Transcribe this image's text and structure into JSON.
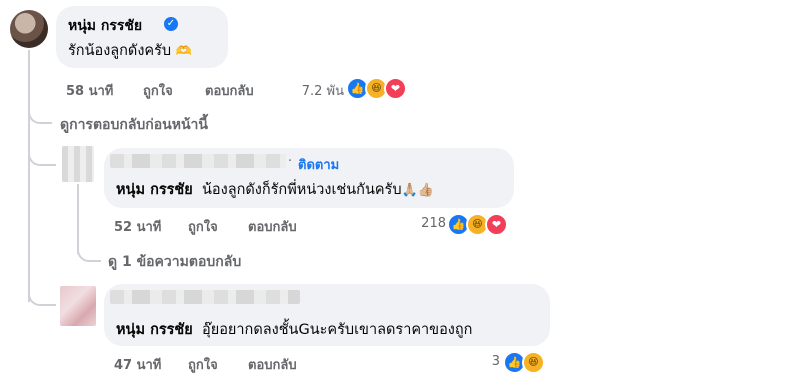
{
  "comment": {
    "author": "หนุ่ม กรรชัย",
    "text": "รักน้องลูกดังครับ",
    "emoji": "🫶",
    "time": "58 นาที",
    "like_label": "ถูกใจ",
    "reply_label": "ตอบกลับ",
    "reaction_count": "7.2 พัน",
    "reactions": [
      "like-icon",
      "haha-icon",
      "love-icon"
    ]
  },
  "view_previous": "ดูการตอบกลับก่อนหน้านี้",
  "replies": [
    {
      "follow_label": "ติดตาม",
      "mention": "หนุ่ม กรรชัย",
      "text": "น้องลูกดังก็รักพี่หน่วงเช่นกันครับ",
      "emoji": "🙏🏼👍🏼",
      "time": "52 นาที",
      "like_label": "ถูกใจ",
      "reply_label": "ตอบกลับ",
      "reaction_count": "218",
      "reactions": [
        "like-icon",
        "haha-icon",
        "love-icon"
      ],
      "view_replies": "ดู 1 ข้อความตอบกลับ"
    },
    {
      "mention": "หนุ่ม กรรชัย",
      "text": "อุ๊ยอยากดลงชั้นGนะครับเขาลดราคาของถูก",
      "time": "47 นาที",
      "like_label": "ถูกใจ",
      "reply_label": "ตอบกลับ",
      "reaction_count": "3",
      "reactions": [
        "like-icon",
        "haha-icon"
      ]
    }
  ],
  "colors": {
    "bubble": "#f0f2f5",
    "meta": "#65676b",
    "accent": "#1877f2",
    "connector": "#cfd2d6"
  }
}
